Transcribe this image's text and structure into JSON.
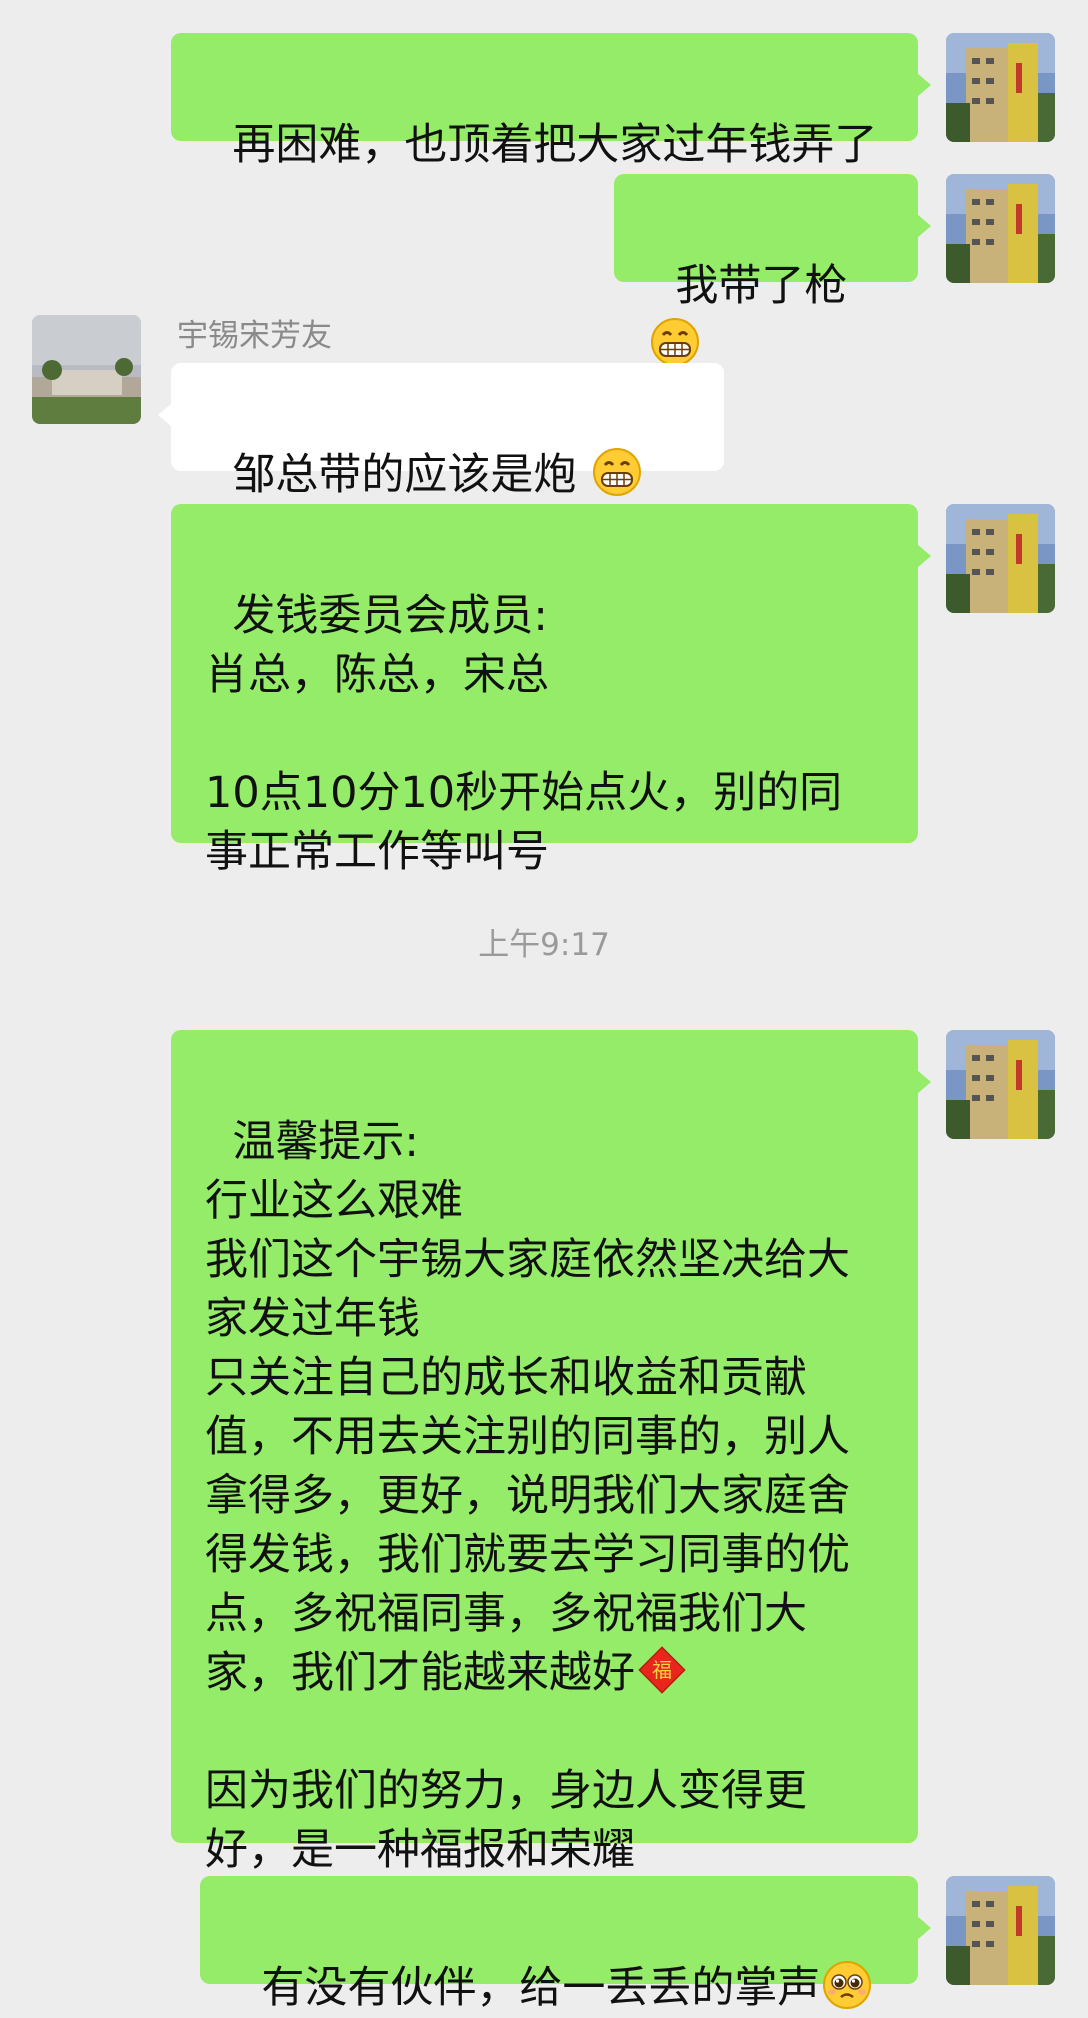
{
  "colors": {
    "background": "#ededed",
    "my_bubble": "#95ec69",
    "other_bubble": "#ffffff",
    "meta_text": "#8a8a8a"
  },
  "messages": [
    {
      "from": "me",
      "text": "再困难，也顶着把大家过年钱弄了"
    },
    {
      "from": "me",
      "text": "我带了枪",
      "emoji": [
        "grin-emoji"
      ]
    },
    {
      "from": "other",
      "sender": "宇锡宋芳友",
      "text": "邹总带的应该是炮 ",
      "emoji": [
        "grin-emoji",
        "grin-emoji"
      ]
    },
    {
      "from": "me",
      "text": "发钱委员会成员:\n肖总，陈总，宋总\n\n10点10分10秒开始点火，别的同事正常工作等叫号"
    },
    {
      "from": "me",
      "text": "温馨提示:\n行业这么艰难\n我们这个宇锡大家庭依然坚决给大家发过年钱\n只关注自己的成长和收益和贡献值，不用去关注别的同事的，别人拿得多，更好，说明我们大家庭舍得发钱，我们就要去学习同事的优点，多祝福同事，多祝福我们大家，我们才能越来越好",
      "emoji_tail": "fu-emoji",
      "text_after": "\n\n因为我们的努力，身边人变得更好，是一种福报和荣耀"
    },
    {
      "from": "me",
      "text": "有没有伙伴，给一丢丢的掌声",
      "emoji": [
        "pleading-emoji"
      ]
    }
  ],
  "timestamp": "上午9:17"
}
